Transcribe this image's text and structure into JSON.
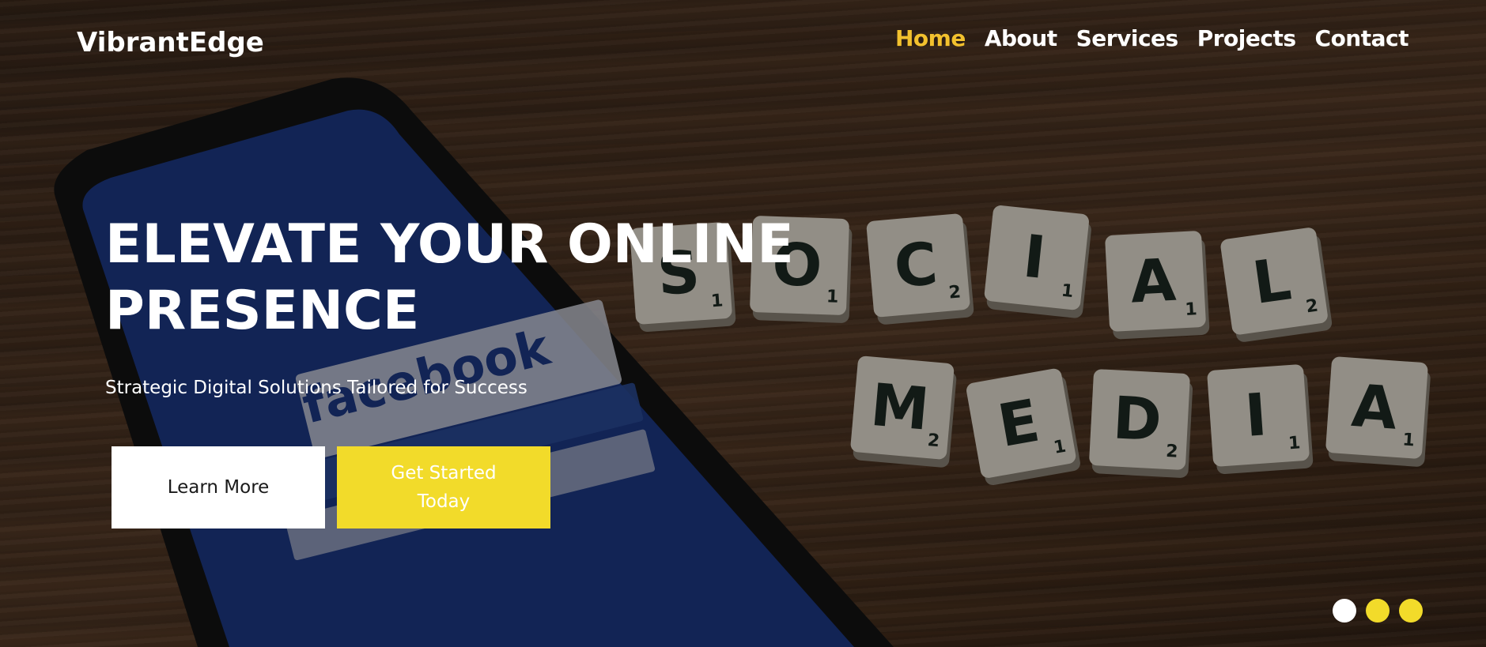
{
  "brand": {
    "logo_text": "VibrantEdge"
  },
  "nav": {
    "items": [
      {
        "label": "Home",
        "active": true
      },
      {
        "label": "About",
        "active": false
      },
      {
        "label": "Services",
        "active": false
      },
      {
        "label": "Projects",
        "active": false
      },
      {
        "label": "Contact",
        "active": false
      }
    ]
  },
  "hero": {
    "headline_line1": "ELEVATE YOUR ONLINE",
    "headline_line2": "PRESENCE",
    "subheadline": "Strategic Digital Solutions Tailored for Success",
    "primary_button": "Learn More",
    "secondary_button": "Get Started Today",
    "background_image_depicts": "smartphone-and-scrabble-tiles-on-wooden-table"
  },
  "photo_text": {
    "tiles_row1": [
      "S",
      "O",
      "C",
      "I",
      "A",
      "L"
    ],
    "tiles_row1_scores": [
      "1",
      "1",
      "2",
      "1",
      "1",
      "2"
    ],
    "tiles_row2": [
      "M",
      "E",
      "D",
      "I",
      "A"
    ],
    "tiles_row2_scores": [
      "2",
      "1",
      "2",
      "1",
      "1"
    ],
    "phone_app_text": "facebook"
  },
  "slider": {
    "dot_count": 3,
    "active_index": 0
  },
  "colors": {
    "accent_yellow": "#f2c12e",
    "button_yellow": "#f2db2a",
    "white": "#ffffff",
    "overlay": "rgba(0,0,0,0.38)",
    "phone_screen_blue": "#1d3a8a"
  }
}
